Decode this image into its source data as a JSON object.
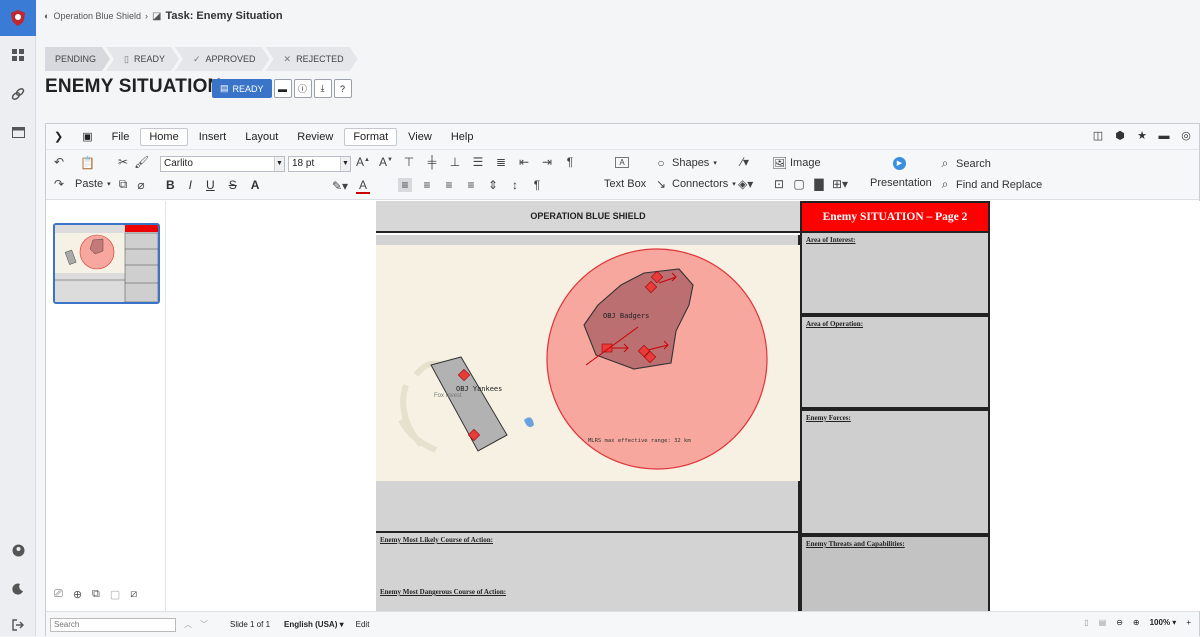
{
  "breadcrumb": {
    "project": "Operation Blue Shield",
    "separator": "›",
    "task": "Task: Enemy Situation"
  },
  "workflow": {
    "steps": [
      {
        "label": "PENDING"
      },
      {
        "label": "READY",
        "icon": "document-icon"
      },
      {
        "label": "APPROVED",
        "icon": "check-icon"
      },
      {
        "label": "REJECTED",
        "icon": "x-icon"
      }
    ]
  },
  "page": {
    "title": "ENEMY SITUATION",
    "status_button": "READY"
  },
  "menu": {
    "items": [
      "File",
      "Home",
      "Insert",
      "Layout",
      "Review",
      "Format",
      "View",
      "Help"
    ],
    "active": "Home"
  },
  "ribbon": {
    "paste_label": "Paste",
    "font_name": "Carlito",
    "font_size": "18 pt",
    "textbox_label": "Text Box",
    "shapes_label": "Shapes",
    "connectors_label": "Connectors",
    "image_label": "Image",
    "presentation_label": "Presentation",
    "search_label": "Search",
    "find_replace_label": "Find and Replace"
  },
  "slide": {
    "header_left": "OPERATION BLUE SHIELD",
    "header_right": "Enemy SITUATION – Page 2",
    "map": {
      "objective_1": "OBJ Badgers",
      "objective_2": "OBJ Yankees",
      "town_label": "Fox Invest",
      "range_note": "MLRS max effective range: 32 km"
    },
    "right_boxes": [
      "Area of Interest:",
      "Area of Operation:",
      "Enemy Forces:",
      "Enemy Threats and Capabilities:"
    ],
    "left_boxes": [
      "Enemy Most Likely Course of Action:",
      "Enemy Most Dangerous Course of Action:"
    ]
  },
  "statusbar": {
    "search_placeholder": "Search",
    "slide_info": "Slide 1 of 1",
    "language": "English (USA)",
    "mode": "Edit",
    "zoom": "100%"
  },
  "colors": {
    "accent": "#3a74c9",
    "header_red": "#ff0000",
    "range_circle": "#f7a79d"
  }
}
